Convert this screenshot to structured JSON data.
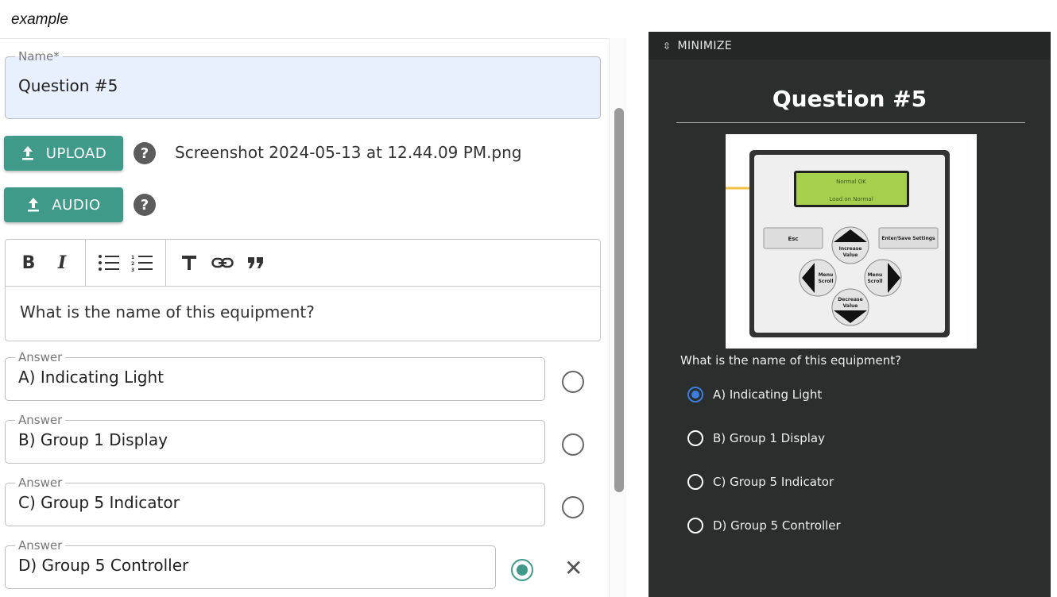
{
  "caption": "example",
  "editor": {
    "name_label": "Name*",
    "name_value": "Question #5",
    "upload_label": "UPLOAD",
    "audio_label": "AUDIO",
    "help_glyph": "?",
    "uploaded_file": "Screenshot 2024-05-13 at 12.44.09 PM.png",
    "toolbar": [
      "bold",
      "italic",
      "bulleted-list",
      "numbered-list",
      "heading",
      "link",
      "quote"
    ],
    "question_text": "What is the name of this equipment?",
    "answer_label": "Answer",
    "answers": [
      {
        "text": "A) Indicating Light",
        "correct": false
      },
      {
        "text": "B) Group 1 Display",
        "correct": false
      },
      {
        "text": "C) Group 5 Indicator",
        "correct": false
      },
      {
        "text": "D) Group 5 Controller",
        "correct": true
      }
    ],
    "accent_color": "#3f9a8a"
  },
  "preview": {
    "minimize_label": "MINIMIZE",
    "title": "Question #5",
    "question": "What is the name of this equipment?",
    "options": [
      "A) Indicating Light",
      "B) Group 1 Display",
      "C) Group 5 Indicator",
      "D) Group 5 Controller"
    ],
    "selected_index": 0,
    "background": "#2a2e2c",
    "image": {
      "lcd_line1": "Normal OK",
      "lcd_line2": "Load on Normal",
      "esc": "Esc",
      "enter": "Enter/Save Settings",
      "increase_1": "Increase",
      "increase_2": "Value",
      "decrease_1": "Decrease",
      "decrease_2": "Value",
      "menu": "Menu",
      "scroll": "Scroll"
    }
  }
}
